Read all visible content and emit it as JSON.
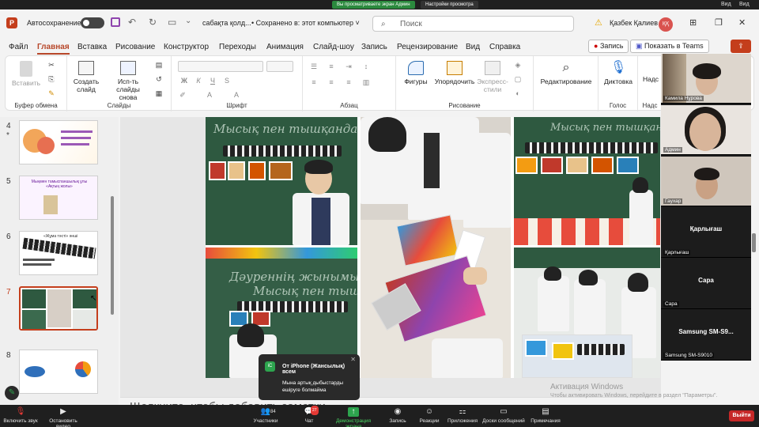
{
  "zoom_top": {
    "sharing_banner": "Вы просматриваете экран Админ",
    "view_options": "Настройки просмотра",
    "view_button": "Вид",
    "view_button2": "Вид"
  },
  "titlebar": {
    "autosave_label": "Автосохранение",
    "filename": "сабақта қолд...",
    "saved_status": "• Сохранено в: этот компьютер ˅",
    "search_placeholder": "Поиск",
    "user_name": "Қазбек Қалиев",
    "user_initials": "ҚҚ"
  },
  "menu": {
    "tabs": [
      "Файл",
      "Главная",
      "Вставка",
      "Рисование",
      "Конструктор",
      "Переходы",
      "Анимация",
      "Слайд-шоу",
      "Запись",
      "Рецензирование",
      "Вид",
      "Справка"
    ],
    "record_button": "Запись",
    "teams_button": "Показать в Teams"
  },
  "ribbon": {
    "paste": "Вставить",
    "clipboard_group": "Буфер обмена",
    "new_slide": "Создать слайд",
    "reuse_slides": "Исп-ть слайды снова",
    "slides_group": "Слайды",
    "font_group": "Шрифт",
    "paragraph_group": "Абзац",
    "shapes": "Фигуры",
    "arrange": "Упорядочить",
    "quick_styles": "Экспресс-стили",
    "drawing_group": "Рисование",
    "editing": "Редактирование",
    "dictate": "Диктовка",
    "voice_group": "Голос",
    "addins": "Надс",
    "addins_group": "Надс"
  },
  "slides": {
    "numbers": [
      "4",
      "5",
      "6",
      "7",
      "8"
    ],
    "thumb_titles": [
      "",
      "Мыңмен тамыспаншылық ұлы «Ақтың жолы»",
      "«Жұма тәсті» әнші",
      "",
      ""
    ],
    "selected_index": 3
  },
  "slide_main": {
    "board_text_1": "Мысық пен тышқандар",
    "board_text_2": "Дәуреннің жынымыз жа",
    "board_text_3": "Мысық пен тышқандар"
  },
  "notes_placeholder": "Щелкните, чтобы добавить заметки",
  "activate_windows": {
    "title": "Активация Windows",
    "subtitle": "Чтобы активировать Windows, перейдите в раздел \"Параметры\"."
  },
  "participants": [
    {
      "name": "Камила Нұрова"
    },
    {
      "name": "Админ"
    },
    {
      "name": "Гаухар"
    },
    {
      "name": "Қарлығаш",
      "center": "Қарлығаш"
    },
    {
      "name": "Сара",
      "center": "Сара"
    },
    {
      "name": "Samsung SM-S9010",
      "center": "Samsung SM-S9..."
    }
  ],
  "notification": {
    "sender_initials": "iC",
    "from": "От iPhone (Жансылық) всем",
    "message": "Мына артық дыбыстарды өшіруге болмайма"
  },
  "zoom_bar": {
    "mute": "Включить звук",
    "video": "Остановить видео",
    "participants": "Участники",
    "participants_count": "84",
    "chat": "Чат",
    "chat_badge": "27",
    "share": "Демонстрация экрана",
    "record": "Запись",
    "reactions": "Реакции",
    "apps": "Приложения",
    "whiteboard": "Доски сообщений",
    "notes": "Примечания",
    "leave": "Выйти"
  },
  "colors": {
    "accent": "#b7472a",
    "zoom_green": "#2da44e",
    "leave_red": "#c62828",
    "board_green": "#2e5940"
  }
}
